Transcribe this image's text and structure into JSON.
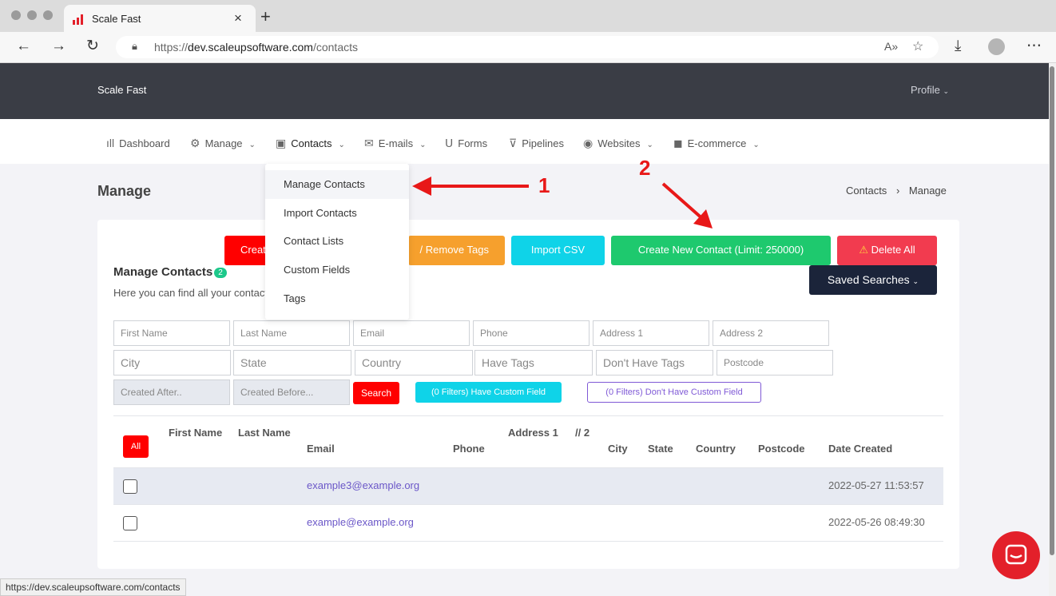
{
  "browser": {
    "tab_title": "Scale Fast",
    "tab_close": "×",
    "new_tab": "+",
    "url_prefix": "https://",
    "url_domain": "dev.scaleupsoftware.com",
    "url_path": "/contacts",
    "status_url": "https://dev.scaleupsoftware.com/contacts"
  },
  "header": {
    "brand": "Scale Fast",
    "profile": "Profile"
  },
  "nav": [
    {
      "label": "Dashboard",
      "icon": "bar-chart-icon",
      "glyph": "ıll",
      "chevron": false
    },
    {
      "label": "Manage",
      "icon": "gear-icon",
      "glyph": "⚙",
      "chevron": true
    },
    {
      "label": "Contacts",
      "icon": "contact-icon",
      "glyph": "▣",
      "chevron": true
    },
    {
      "label": "E-mails",
      "icon": "email-icon",
      "glyph": "✉",
      "chevron": true
    },
    {
      "label": "Forms",
      "icon": "magnet-icon",
      "glyph": "Ս",
      "chevron": false
    },
    {
      "label": "Pipelines",
      "icon": "filter-icon",
      "glyph": "⊽",
      "chevron": false
    },
    {
      "label": "Websites",
      "icon": "globe-icon",
      "glyph": "◉",
      "chevron": true
    },
    {
      "label": "E-commerce",
      "icon": "cart-icon",
      "glyph": "◼",
      "chevron": true
    }
  ],
  "page": {
    "title": "Manage",
    "breadcrumb": [
      "Contacts",
      "›",
      "Manage"
    ]
  },
  "actions": {
    "create": "Create",
    "tags": "/ Remove Tags",
    "import_csv": "Import CSV",
    "create_new": "Create New Contact (Limit: 250000)",
    "delete_all": "Delete All",
    "saved_searches": "Saved Searches"
  },
  "card": {
    "heading": "Manage Contacts",
    "count": "2",
    "subheading": "Here you can find all your contacts"
  },
  "filters": {
    "row1": [
      "First Name",
      "Last Name",
      "Email",
      "Phone",
      "Address 1",
      "Address 2"
    ],
    "row2": [
      "City",
      "State",
      "Country",
      "Have Tags",
      "Don't Have Tags",
      "Postcode"
    ],
    "created_after": "Created After..",
    "created_before": "Created Before...",
    "search": "Search",
    "have_custom": "(0 Filters) Have Custom Field",
    "dont_have_custom": "(0 Filters) Don't Have Custom Field"
  },
  "table": {
    "all_button": "All",
    "headers": [
      "First Name",
      "Last Name",
      "Email",
      "Phone",
      "Address 1",
      "// 2",
      "City",
      "State",
      "Country",
      "Postcode",
      "Date Created"
    ],
    "rows": [
      {
        "email": "example3@example.org",
        "date": "2022-05-27 11:53:57"
      },
      {
        "email": "example@example.org",
        "date": "2022-05-26 08:49:30"
      }
    ]
  },
  "dropdown": [
    "Manage Contacts",
    "Import Contacts",
    "Contact Lists",
    "Custom Fields",
    "Tags"
  ],
  "annotations": {
    "one": "1",
    "two": "2"
  },
  "colors": {
    "red": "#ff0000",
    "orange": "#f6a02d",
    "cyan": "#0fd3e8",
    "green": "#1ec96e",
    "danger": "#f23b4f",
    "navy": "#1b243a",
    "purple": "#7f59d6"
  }
}
